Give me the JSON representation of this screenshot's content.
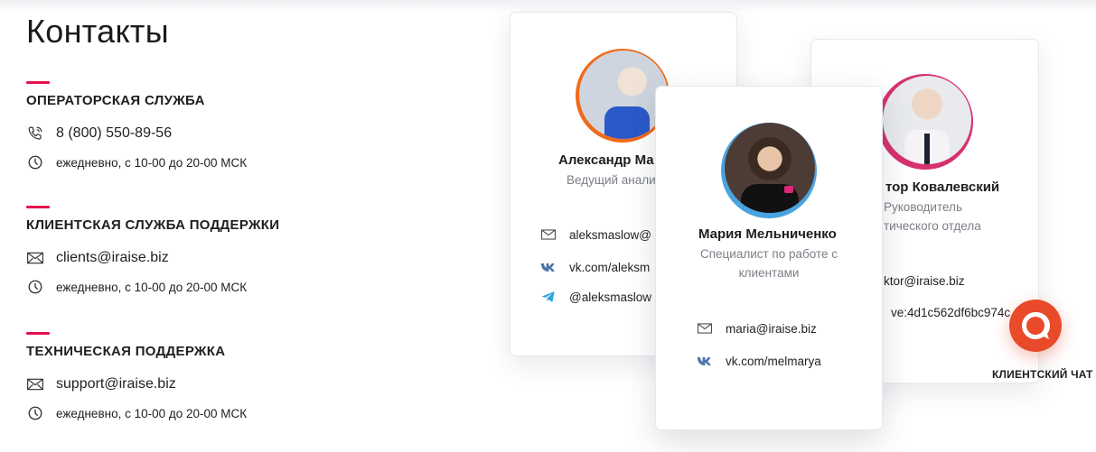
{
  "page": {
    "title": "Контакты"
  },
  "sections": [
    {
      "heading": "ОПЕРАТОРСКАЯ СЛУЖБА",
      "contact": "8 (800) 550-89-56",
      "schedule": "ежедневно, с 10-00 до 20-00 МСК",
      "contact_icon": "phone-icon"
    },
    {
      "heading": "КЛИЕНТСКАЯ СЛУЖБА ПОДДЕРЖКИ",
      "contact": "clients@iraise.biz",
      "schedule": "ежедневно, с 10-00 до 20-00 МСК",
      "contact_icon": "mail-icon"
    },
    {
      "heading": "ТЕХНИЧЕСКАЯ ПОДДЕРЖКА",
      "contact": "support@iraise.biz",
      "schedule": "ежедневно, с 10-00 до 20-00 МСК",
      "contact_icon": "mail-icon"
    }
  ],
  "cards": [
    {
      "name": "Александр Ма",
      "role": "Ведущий анали",
      "ring_color": "#f06a19",
      "contacts": [
        {
          "icon": "mail-icon",
          "text": "aleksmaslow@"
        },
        {
          "icon": "vk-icon",
          "text": "vk.com/aleksm"
        },
        {
          "icon": "telegram-icon",
          "text": "@aleksmaslow"
        }
      ]
    },
    {
      "name": "Мария Мельниченко",
      "role": "Специалист по работе с клиентами",
      "ring_color": "#4aa3df",
      "contacts": [
        {
          "icon": "mail-icon",
          "text": "maria@iraise.biz"
        },
        {
          "icon": "vk-icon",
          "text": "vk.com/melmarya"
        }
      ]
    },
    {
      "name": "тор Ковалевский",
      "role_line1": "Руководитель",
      "role_line2": "тического отдела",
      "ring_color": "#d6316f",
      "contacts": [
        {
          "icon": "mail-icon",
          "text": "ktor@iraise.biz"
        },
        {
          "icon": "skype-icon",
          "text": "ve:4d1c562df6bc974c"
        }
      ]
    }
  ],
  "chat": {
    "label": "КЛИЕНТСКИЙ ЧАТ",
    "icon": "chat-bubble-icon",
    "color": "#e84a2a"
  },
  "colors": {
    "accent": "#e3114f",
    "muted": "#7b7f86",
    "vk": "#4a76a8",
    "telegram": "#2ca5e0"
  }
}
